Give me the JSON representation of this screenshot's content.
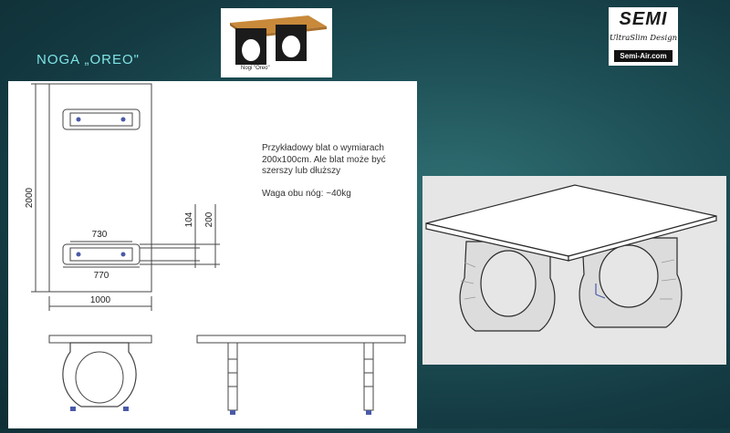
{
  "slide": {
    "title": "NOGA „OREO\"",
    "photo_caption": "Nogi  \"Oreo\"",
    "logo": {
      "brand": "SEMI",
      "slogan": "UltraSlim Design",
      "url": "Semi-Air.com"
    },
    "note": {
      "line1": "Przykładowy blat o wymiarach",
      "line2": "200x100cm. Ale blat może być",
      "line3": "szerszy lub dłuższy",
      "weight": "Waga obu nóg: ~40kg"
    },
    "dimensions": {
      "length": "2000",
      "width": "1000",
      "leg_inner": "730",
      "leg_outer": "770",
      "leg_depth_a": "104",
      "leg_depth_b": "200"
    }
  },
  "colors": {
    "title": "#7fe3e6",
    "wood": "#c8893a",
    "leg": "#1b1b1b"
  }
}
